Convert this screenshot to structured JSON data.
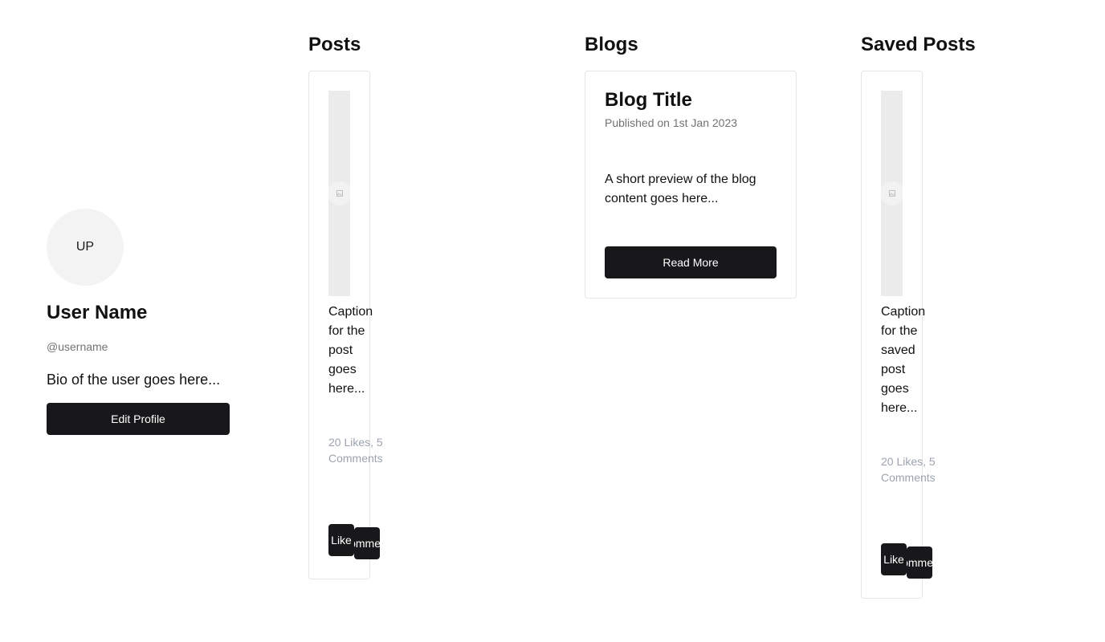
{
  "profile": {
    "initials": "UP",
    "name": "User Name",
    "handle": "@username",
    "bio": "Bio of the user goes here...",
    "edit_label": "Edit Profile"
  },
  "posts": {
    "title": "Posts",
    "caption": "Caption for the post goes here...",
    "stats": "20 Likes, 5 Comments",
    "like_label": "Like",
    "comment_label": "Comment"
  },
  "blogs": {
    "title": "Blogs",
    "blog_title": "Blog Title",
    "published": "Published on 1st Jan 2023",
    "preview": "A short preview of the blog content goes here...",
    "read_more_label": "Read More"
  },
  "saved": {
    "title": "Saved Posts",
    "caption": "Caption for the saved post goes here...",
    "stats": "20 Likes, 5 Comments",
    "like_label": "Like",
    "comment_label": "Comment"
  },
  "icons": {
    "image_placeholder": "image-icon"
  },
  "colors": {
    "button": "#18181b",
    "muted_text": "#737373",
    "stats_text": "#9ca3af",
    "image_bg": "#ebebeb"
  }
}
